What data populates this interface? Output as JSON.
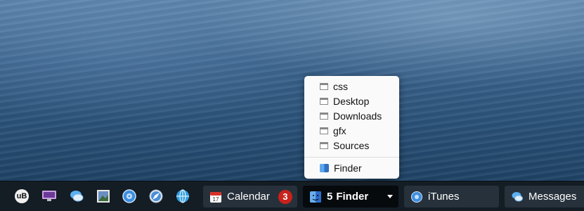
{
  "menu": {
    "folders": [
      "css",
      "Desktop",
      "Downloads",
      "gfx",
      "Sources"
    ],
    "app_item": "Finder"
  },
  "taskbar": {
    "quick_icons": [
      {
        "name": "ublock-icon",
        "text": "uB"
      },
      {
        "name": "display-icon"
      },
      {
        "name": "messages-icon"
      },
      {
        "name": "preview-icon"
      },
      {
        "name": "itunes-icon"
      },
      {
        "name": "safari-icon"
      },
      {
        "name": "globe-icon"
      }
    ],
    "calendar": {
      "label": "Calendar",
      "badge": "3",
      "date": "17"
    },
    "finder": {
      "count": "5",
      "label": "Finder"
    },
    "itunes": {
      "label": "iTunes"
    },
    "messages": {
      "label": "Messages"
    }
  },
  "colors": {
    "badge": "#c9221b",
    "taskbar": "#141c24",
    "button": "#27313b"
  }
}
